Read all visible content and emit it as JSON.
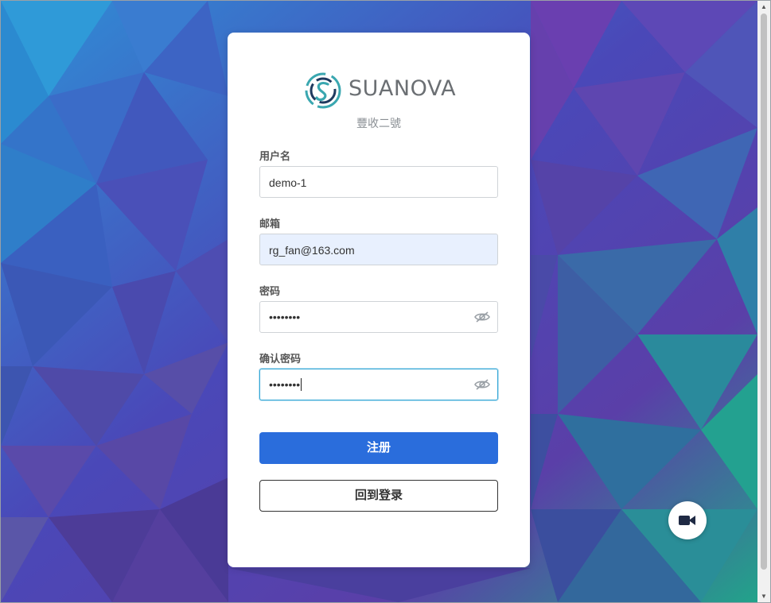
{
  "brand": {
    "logo_text": "SUANOVA",
    "subtitle": "豐收二號"
  },
  "form": {
    "username": {
      "label": "用户名",
      "value": "demo-1"
    },
    "email": {
      "label": "邮箱",
      "value": "rg_fan@163.com"
    },
    "password": {
      "label": "密码",
      "masked_value": "••••••••",
      "icon": "eye-slash-icon"
    },
    "confirm_password": {
      "label": "确认密码",
      "masked_value": "••••••••",
      "icon": "eye-slash-icon"
    }
  },
  "actions": {
    "register_label": "注册",
    "back_to_login_label": "回到登录"
  },
  "floating": {
    "icon": "video-camera-icon"
  },
  "colors": {
    "primary": "#2a6ddc",
    "focus_border": "#35a7d6",
    "autofill_bg": "#e8f0fe",
    "logo_teal": "#3aa7b0",
    "logo_navy": "#1f3a5f"
  }
}
